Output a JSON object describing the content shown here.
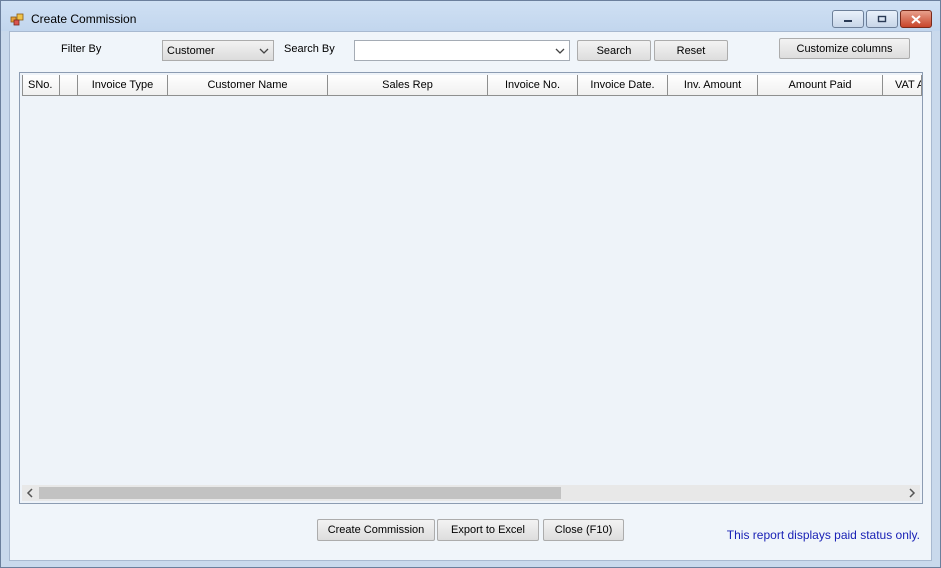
{
  "window": {
    "title": "Create Commission"
  },
  "toolbar": {
    "filter_by_label": "Filter By",
    "filter_by_value": "Customer",
    "search_by_label": "Search By",
    "search_by_value": "",
    "search_button": "Search",
    "reset_button": "Reset",
    "customize_button": "Customize columns"
  },
  "grid": {
    "columns": [
      "SNo.",
      "",
      "Invoice Type",
      "Customer Name",
      "Sales Rep",
      "Invoice No.",
      "Invoice Date.",
      "Inv. Amount",
      "Amount Paid",
      "VAT A"
    ],
    "rows": []
  },
  "footer": {
    "create_button": "Create Commission",
    "export_button": "Export to Excel",
    "close_button": "Close (F10)",
    "status_note": "This report displays paid status only."
  },
  "colors": {
    "note": "#1a22b6",
    "close_caption": "#c8452b"
  },
  "icons": [
    "app-icon",
    "minimize-icon",
    "restore-icon",
    "close-icon",
    "chevron-down-icon",
    "scroll-left-icon",
    "scroll-right-icon"
  ]
}
